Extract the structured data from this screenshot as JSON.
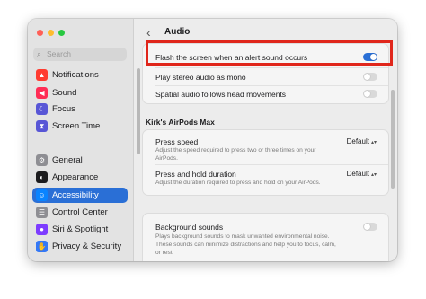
{
  "sidebar": {
    "search_placeholder": "Search",
    "items": [
      {
        "label": "Notifications",
        "icon": "bell-icon",
        "color": "#ff3b30",
        "glyph": "▲",
        "active": false
      },
      {
        "label": "Sound",
        "icon": "speaker-icon",
        "color": "#ff2d55",
        "glyph": "◀",
        "active": false
      },
      {
        "label": "Focus",
        "icon": "moon-icon",
        "color": "#5856d6",
        "glyph": "☾",
        "active": false
      },
      {
        "label": "Screen Time",
        "icon": "hourglass-icon",
        "color": "#5856d6",
        "glyph": "⧗",
        "active": false
      },
      {
        "label": "General",
        "icon": "gear-icon",
        "color": "#8e8e93",
        "glyph": "⚙",
        "active": false
      },
      {
        "label": "Appearance",
        "icon": "appearance-icon",
        "color": "#1c1c1e",
        "glyph": "◐",
        "active": false
      },
      {
        "label": "Accessibility",
        "icon": "accessibility-icon",
        "color": "#0a84ff",
        "glyph": "☺",
        "active": true
      },
      {
        "label": "Control Center",
        "icon": "control-center-icon",
        "color": "#8e8e93",
        "glyph": "☰",
        "active": false
      },
      {
        "label": "Siri & Spotlight",
        "icon": "siri-icon",
        "color": "#7d3cff",
        "glyph": "●",
        "active": false
      },
      {
        "label": "Privacy & Security",
        "icon": "hand-icon",
        "color": "#3478f6",
        "glyph": "✋",
        "active": false
      }
    ]
  },
  "main": {
    "title": "Audio",
    "back_glyph": "‹",
    "flash_label": "Flash the screen when an alert sound occurs",
    "flash_on": true,
    "mono_label": "Play stereo audio as mono",
    "mono_on": false,
    "spatial_label": "Spatial audio follows head movements",
    "spatial_on": false,
    "airpods_heading": "Kirk's AirPods Max",
    "press_speed_label": "Press speed",
    "press_speed_desc": "Adjust the speed required to press two or three times on your AirPods.",
    "press_speed_value": "Default",
    "press_hold_label": "Press and hold duration",
    "press_hold_desc": "Adjust the duration required to press and hold on your AirPods.",
    "press_hold_value": "Default",
    "bg_label": "Background sounds",
    "bg_desc": "Plays background sounds to mask unwanted environmental noise. These sounds can minimize distractions and help you to focus, calm, or rest.",
    "bg_on": false
  },
  "colors": {
    "accent": "#2a6fd6",
    "highlight": "#e0261b"
  }
}
